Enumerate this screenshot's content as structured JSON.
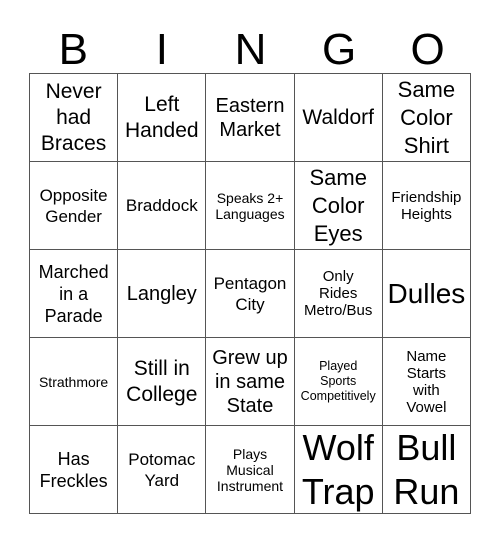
{
  "header": [
    "B",
    "I",
    "N",
    "G",
    "O"
  ],
  "cells": [
    "Never had Braces",
    "Left Handed",
    "Eastern Market",
    "Waldorf",
    "Same Color Shirt",
    "Opposite Gender",
    "Braddock",
    "Speaks 2+ Languages",
    "Same Color Eyes",
    "Friendship Heights",
    "Marched in a Parade",
    "Langley",
    "Pentagon City",
    "Only Rides Metro/Bus",
    "Dulles",
    "Strathmore",
    "Still in College",
    "Grew up in same State",
    "Played Sports Competitively",
    "Name Starts with Vowel",
    "Has Freckles",
    "Potomac Yard",
    "Plays Musical Instrument",
    "Wolf Trap",
    "Bull Run"
  ]
}
